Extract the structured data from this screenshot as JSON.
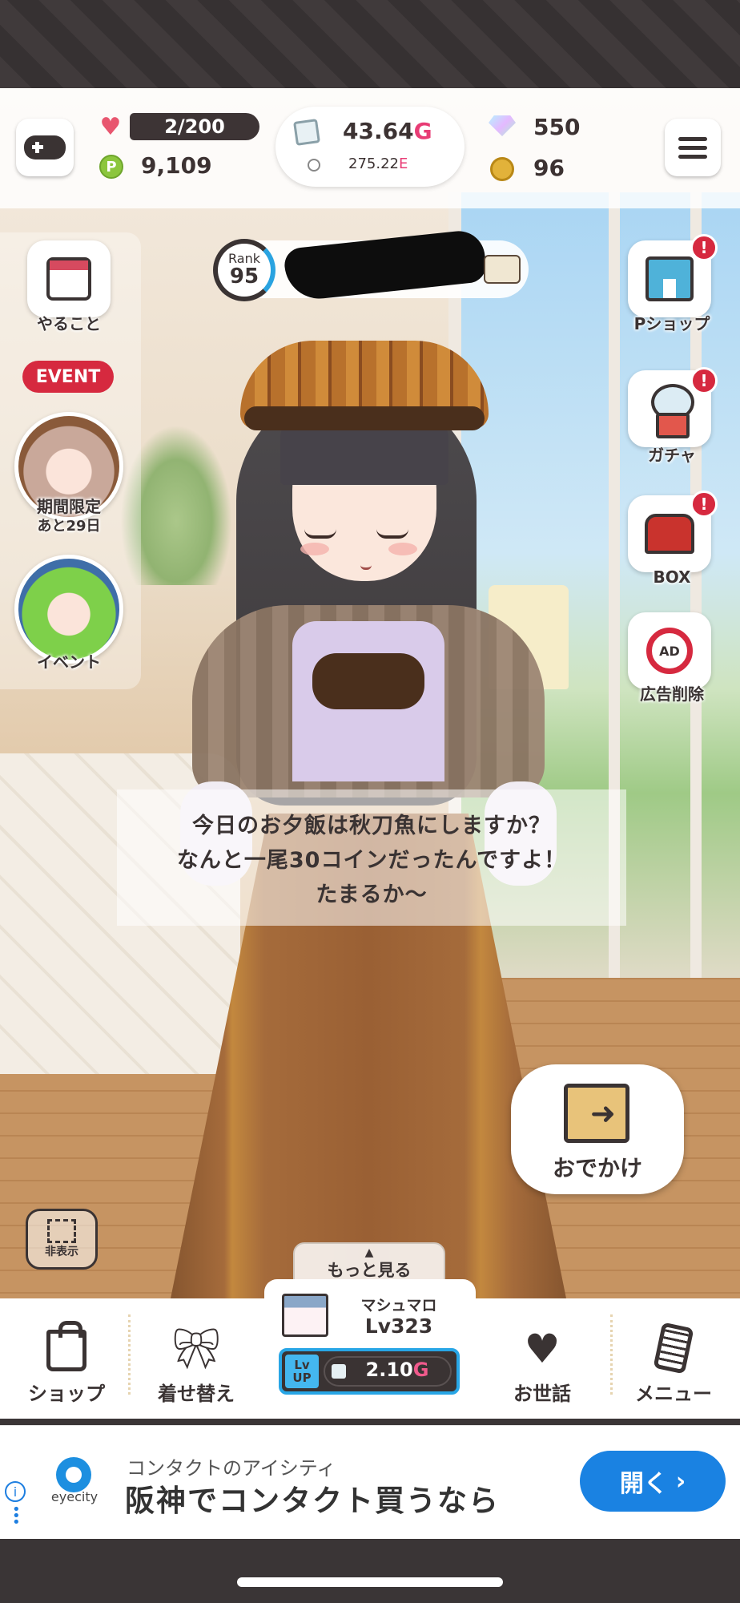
{
  "hud": {
    "stamina": "2/200",
    "points": "9,109",
    "gold_value": "43.64",
    "gold_unit": "G",
    "energy_value": "275.22",
    "energy_unit": "E",
    "diamonds": "550",
    "coins": "96"
  },
  "rank": {
    "label": "Rank",
    "value": "95"
  },
  "left_menu": {
    "todo_label": "やること",
    "event_pill": "EVENT",
    "limited_label": "期間限定",
    "limited_remaining": "あと29日",
    "event_label": "イベント"
  },
  "right_menu": {
    "pshop_label": "Pショップ",
    "gacha_label": "ガチャ",
    "box_label": "BOX",
    "noads_label": "広告削除",
    "noads_icon_text": "AD",
    "alert_mark": "!"
  },
  "speech": {
    "lines": [
      "今日のお夕飯は秋刀魚にしますか？",
      "なんと一尾30コインだったんですよ！",
      "たまるか〜"
    ]
  },
  "outing_label": "おでかけ",
  "hide_label": "非表示",
  "more_label": "もっと見る",
  "nav": {
    "shop": "ショップ",
    "dressup": "着せ替え",
    "care": "お世話",
    "menu": "メニュー"
  },
  "levelup": {
    "food_name": "マシュマロ",
    "food_level": "Lv323",
    "tag": "Lv UP",
    "cost_value": "2.10",
    "cost_unit": "G"
  },
  "ad": {
    "brand": "eyecity",
    "subtitle": "コンタクトのアイシティ",
    "title": "阪神でコンタクト買うなら",
    "open_label": "開く",
    "open_arrow": "›"
  },
  "colors": {
    "accent_red": "#d6293f",
    "gold_pink": "#e83c75",
    "lvup_blue": "#28a6e6",
    "ad_blue": "#1a82e2"
  }
}
